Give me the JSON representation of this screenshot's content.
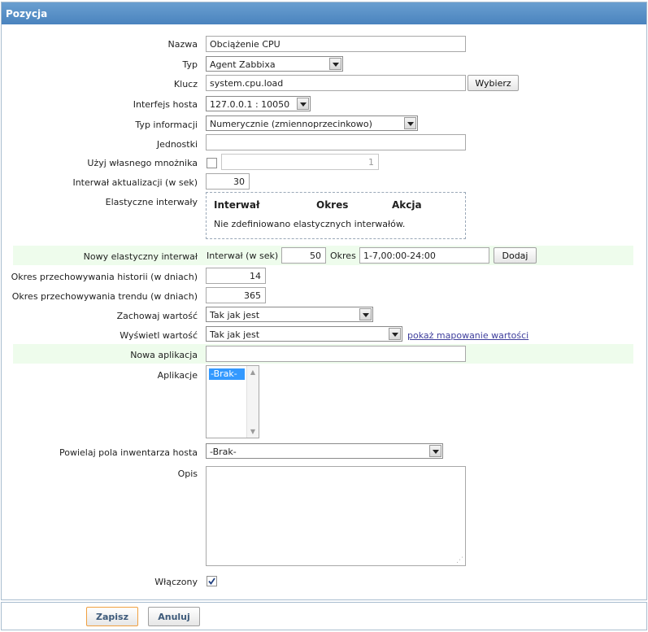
{
  "header": {
    "title": "Pozycja"
  },
  "form": {
    "name": {
      "label": "Nazwa",
      "value": "Obciążenie CPU"
    },
    "type": {
      "label": "Typ",
      "value": "Agent Zabbixa"
    },
    "key": {
      "label": "Klucz",
      "value": "system.cpu.load",
      "select_label": "Wybierz"
    },
    "host_interface": {
      "label": "Interfejs hosta",
      "value": "127.0.0.1 : 10050"
    },
    "info_type": {
      "label": "Typ informacji",
      "value": "Numerycznie (zmiennoprzecinkowo)"
    },
    "units": {
      "label": "Jednostki",
      "value": ""
    },
    "multiplier": {
      "label": "Użyj własnego mnożnika",
      "checked": false,
      "value": "1"
    },
    "update_interval": {
      "label": "Interwał aktualizacji (w sek)",
      "value": "30"
    },
    "flexible_intervals": {
      "label": "Elastyczne interwały",
      "columns": [
        "Interwał",
        "Okres",
        "Akcja"
      ],
      "empty_text": "Nie zdefiniowano elastycznych interwałów."
    },
    "new_flexible": {
      "label": "Nowy elastyczny interwał",
      "interval_label": "Interwał (w sek)",
      "interval_value": "50",
      "period_label": "Okres",
      "period_value": "1-7,00:00-24:00",
      "add_label": "Dodaj"
    },
    "history": {
      "label": "Okres przechowywania historii (w dniach)",
      "value": "14"
    },
    "trends": {
      "label": "Okres przechowywania trendu (w dniach)",
      "value": "365"
    },
    "store_value": {
      "label": "Zachowaj wartość",
      "value": "Tak jak jest"
    },
    "show_value": {
      "label": "Wyświetl wartość",
      "value": "Tak jak jest",
      "link": "pokaż mapowanie wartości"
    },
    "new_application": {
      "label": "Nowa aplikacja",
      "value": ""
    },
    "applications": {
      "label": "Aplikacje",
      "options": [
        "-Brak-"
      ],
      "selected": "-Brak-"
    },
    "inventory": {
      "label": "Powielaj pola inwentarza hosta",
      "value": "-Brak-"
    },
    "description": {
      "label": "Opis",
      "value": ""
    },
    "enabled": {
      "label": "Włączony",
      "checked": true
    }
  },
  "footer": {
    "save_label": "Zapisz",
    "cancel_label": "Anuluj"
  }
}
